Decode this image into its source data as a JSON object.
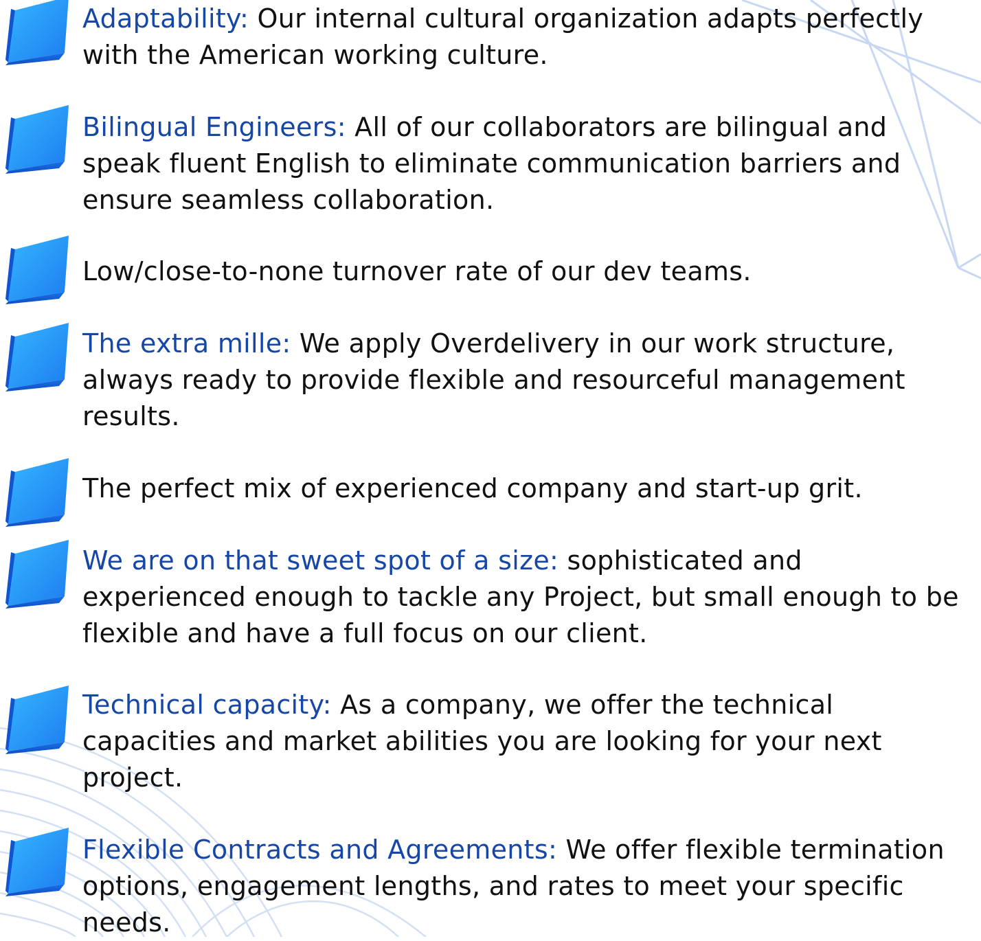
{
  "colors": {
    "accent": "#1747a6",
    "text": "#111111",
    "bullet_light": "#38b8ff",
    "bullet_dark": "#1468e6",
    "background_lines": "#c8d8f2"
  },
  "bullet_icon": "blue-cube-icon",
  "items": [
    {
      "term": "Adaptability:",
      "text": " Our internal cultural organization adapts perfectly with the American working culture."
    },
    {
      "term": "Bilingual Engineers:",
      "text": " All of our collaborators are bilingual and speak fluent English to eliminate communication barriers and ensure seamless collaboration."
    },
    {
      "term": "",
      "text": "Low/close-to-none turnover rate of our dev teams."
    },
    {
      "term": "The extra mille:",
      "text": " We apply Overdelivery in our work structure, always ready to provide flexible and resourceful management results."
    },
    {
      "term": "",
      "text": "The perfect mix of experienced company and start-up grit."
    },
    {
      "term": "We are on that sweet spot of a size:",
      "text": " sophisticated and experienced enough to tackle any Project, but small enough to be flexible and have a full focus on our client."
    },
    {
      "term": "Technical capacity:",
      "text": " As a company, we offer the technical capacities and market abilities you are looking for your next project."
    },
    {
      "term": "Flexible Contracts and Agreements:",
      "text": " We offer flexible termination options, engagement lengths, and rates to meet your specific needs."
    }
  ]
}
